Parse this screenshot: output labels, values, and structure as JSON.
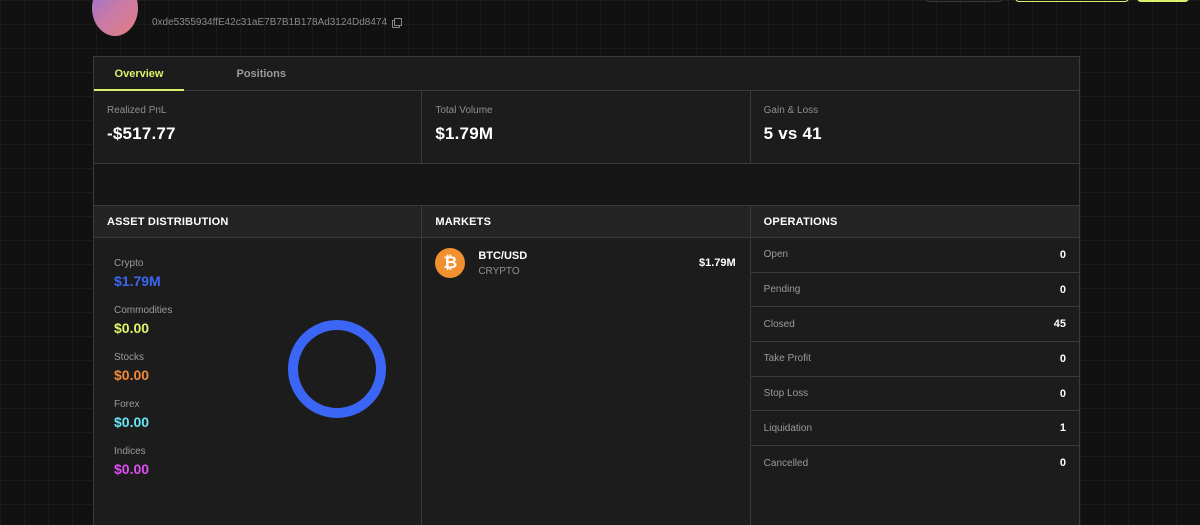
{
  "profile": {
    "address": "0xde5355934ffE42c31aE7B7B1B178Ad3124Dd8474"
  },
  "tabs": [
    {
      "label": "Overview"
    },
    {
      "label": "Positions"
    }
  ],
  "stats": [
    {
      "label": "Realized PnL",
      "value": "-$517.77"
    },
    {
      "label": "Total Volume",
      "value": "$1.79M"
    },
    {
      "label": "Gain & Loss",
      "value": "5 vs 41"
    }
  ],
  "asset_distribution": {
    "title": "ASSET DISTRIBUTION",
    "items": [
      {
        "label": "Crypto",
        "value": "$1.79M",
        "color": "#3b66f5"
      },
      {
        "label": "Commodities",
        "value": "$0.00",
        "color": "#e1f56b"
      },
      {
        "label": "Stocks",
        "value": "$0.00",
        "color": "#f08a3a"
      },
      {
        "label": "Forex",
        "value": "$0.00",
        "color": "#68e6f2"
      },
      {
        "label": "Indices",
        "value": "$0.00",
        "color": "#e04ef5"
      }
    ],
    "donut_color": "#3b66f5"
  },
  "markets": {
    "title": "MARKETS",
    "items": [
      {
        "icon": "bitcoin-icon",
        "symbol_glyph": "₿",
        "name": "BTC/USD",
        "type": "CRYPTO",
        "value": "$1.79M"
      }
    ]
  },
  "operations": {
    "title": "OPERATIONS",
    "items": [
      {
        "label": "Open",
        "value": "0"
      },
      {
        "label": "Pending",
        "value": "0"
      },
      {
        "label": "Closed",
        "value": "45"
      },
      {
        "label": "Take Profit",
        "value": "0"
      },
      {
        "label": "Stop Loss",
        "value": "0"
      },
      {
        "label": "Liquidation",
        "value": "1"
      },
      {
        "label": "Cancelled",
        "value": "0"
      }
    ]
  },
  "colors": {
    "accent": "#d9f26b",
    "bitcoin": "#f0902f"
  }
}
